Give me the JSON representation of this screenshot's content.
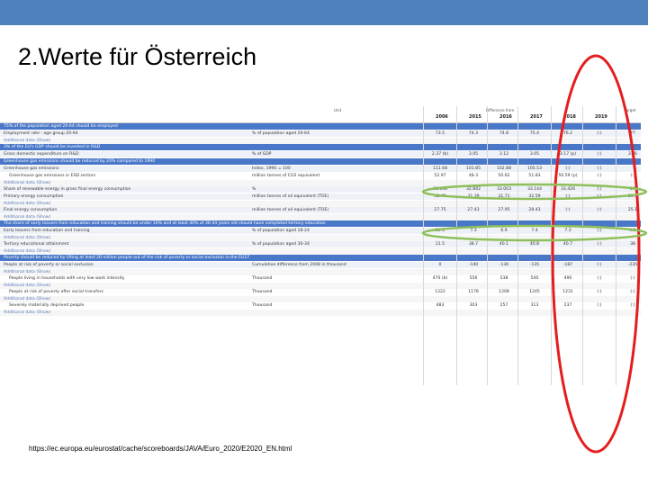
{
  "slide": {
    "title": "2.Werte für Österreich",
    "url": "https://ec.europa.eu/eurostat/cache/scoreboards/JAVA/Euro_2020/E2020_EN.html",
    "topbar_color": "#4f81bd"
  },
  "table": {
    "unit_header": "Unit",
    "target_header": "Target",
    "group_header": "Difference from",
    "years": [
      "2006",
      "2015",
      "2016",
      "2017",
      "2018",
      "2019"
    ],
    "rows": [
      {
        "type": "section",
        "label": "75% of the population aged 20-64 should be employed",
        "unit": "",
        "values": [
          "",
          "",
          "",
          "",
          "",
          ""
        ],
        "target": ""
      },
      {
        "type": "main",
        "label": "Employment rate - age group 20-64",
        "unit": "% of population aged 20-64",
        "values": [
          "73.5",
          "74.3",
          "74.8",
          "75.4",
          "76.2",
          "(:)"
        ],
        "target": "77"
      },
      {
        "type": "extra",
        "label": "Additional data (Show)",
        "unit": "",
        "values": [
          "",
          "",
          "",
          "",
          "",
          ""
        ],
        "target": ""
      },
      {
        "type": "section",
        "label": "3% of the EU's GDP should be invested in R&D",
        "unit": "",
        "values": [
          "",
          "",
          "",
          "",
          "",
          ""
        ],
        "target": ""
      },
      {
        "type": "main",
        "label": "Gross domestic expenditure on R&D",
        "unit": "% of GDP",
        "values": [
          "2.37 (b)",
          "3.05",
          "3.12",
          "3.05",
          "3.17 (p)",
          "(:)"
        ],
        "target": "3.76"
      },
      {
        "type": "section",
        "label": "Greenhouse gas emissions should be reduced by 20% compared to 1990",
        "unit": "",
        "values": [
          "",
          "",
          "",
          "",
          "",
          ""
        ],
        "target": ""
      },
      {
        "type": "main",
        "label": "Greenhouse gas emissions",
        "unit": "Index, 1990 = 100",
        "values": [
          "111.68",
          "101.85",
          "102.88",
          "105.53",
          "(:)",
          "(:)"
        ],
        "target": ""
      },
      {
        "type": "sub",
        "label": "Greenhouse gas emissions in ESD sectors",
        "unit": "million tonnes of CO2 equivalent",
        "values": [
          "52.97",
          "48.3",
          "50.62",
          "51.83",
          "50.59 (p)",
          "(:)"
        ],
        "target": "(:)"
      },
      {
        "type": "extra",
        "label": "Additional data (Show)",
        "unit": "",
        "values": [
          "",
          "",
          "",
          "",
          "",
          ""
        ],
        "target": ""
      },
      {
        "type": "main",
        "label": "Share of renewable energy in gross final energy consumption",
        "unit": "%",
        "values": [
          "26.698",
          "32.842",
          "33.003",
          "33.144",
          "33.426",
          "(:)"
        ],
        "target": "34"
      },
      {
        "type": "main",
        "label": "Primary energy consumption",
        "unit": "million tonnes of oil equivalent (TOE)",
        "values": [
          "32.49",
          "31.39",
          "31.71",
          "32.59",
          "(:)",
          "(:)"
        ],
        "target": "31.5"
      },
      {
        "type": "extra",
        "label": "Additional data (Show)",
        "unit": "",
        "values": [
          "",
          "",
          "",
          "",
          "",
          ""
        ],
        "target": ""
      },
      {
        "type": "main",
        "label": "Final energy consumption",
        "unit": "million tonnes of oil equivalent (TOE)",
        "values": [
          "27.75",
          "27.43",
          "27.95",
          "28.43",
          "(:)",
          "(:)"
        ],
        "target": "25.1"
      },
      {
        "type": "extra",
        "label": "Additional data (Show)",
        "unit": "",
        "values": [
          "",
          "",
          "",
          "",
          "",
          ""
        ],
        "target": ""
      },
      {
        "type": "section",
        "label": "The share of early leavers from education and training should be under 10% and at least 40% of 30-34 years old should have completed tertiary education",
        "unit": "",
        "values": [
          "",
          "",
          "",
          "",
          "",
          ""
        ],
        "target": ""
      },
      {
        "type": "main",
        "label": "Early leavers from education and training",
        "unit": "% of population aged 18-24",
        "values": [
          "10.1",
          "7.3",
          "6.9",
          "7.4",
          "7.3",
          "(:)"
        ],
        "target": "9.5"
      },
      {
        "type": "extra",
        "label": "Additional data (Show)",
        "unit": "",
        "values": [
          "",
          "",
          "",
          "",
          "",
          ""
        ],
        "target": ""
      },
      {
        "type": "main",
        "label": "Tertiary educational attainment",
        "unit": "% of population aged 30-34",
        "values": [
          "21.5",
          "38.7",
          "40.1",
          "40.8",
          "40.7",
          "(:)"
        ],
        "target": "38"
      },
      {
        "type": "extra",
        "label": "Additional data (Show)",
        "unit": "",
        "values": [
          "",
          "",
          "",
          "",
          "",
          ""
        ],
        "target": ""
      },
      {
        "type": "section",
        "label": "Poverty should be reduced by lifting at least 20 million people out of the risk of poverty or social exclusion in the EU27",
        "unit": "",
        "values": [
          "",
          "",
          "",
          "",
          "",
          ""
        ],
        "target": ""
      },
      {
        "type": "main",
        "label": "People at risk of poverty or social exclusion",
        "unit": "Cumulative difference from 2008 in thousand",
        "values": [
          "0",
          "-140",
          "-136",
          "-135",
          "-187",
          "(:)"
        ],
        "target": "-235"
      },
      {
        "type": "extra",
        "label": "Additional data (Show)",
        "unit": "",
        "values": [
          "",
          "",
          "",
          "",
          "",
          ""
        ],
        "target": ""
      },
      {
        "type": "sub",
        "label": "People living in households with very low work intensity",
        "unit": "Thousand",
        "values": [
          "470 (b)",
          "556",
          "538",
          "540",
          "490",
          "(:)"
        ],
        "target": "(:)"
      },
      {
        "type": "extra",
        "label": "Additional data (Show)",
        "unit": "",
        "values": [
          "",
          "",
          "",
          "",
          "",
          ""
        ],
        "target": ""
      },
      {
        "type": "sub",
        "label": "People at risk of poverty after social transfers",
        "unit": "Thousand",
        "values": [
          "1222",
          "1178",
          "1208",
          "1245",
          "1231",
          "(:)"
        ],
        "target": "(:)"
      },
      {
        "type": "extra",
        "label": "Additional data (Show)",
        "unit": "",
        "values": [
          "",
          "",
          "",
          "",
          "",
          ""
        ],
        "target": ""
      },
      {
        "type": "sub",
        "label": "Severely materially deprived people",
        "unit": "Thousand",
        "values": [
          "483",
          "303",
          "257",
          "313",
          "237",
          "(:)"
        ],
        "target": "(:)"
      },
      {
        "type": "extra",
        "label": "Additional data (Show)",
        "unit": "",
        "values": [
          "",
          "",
          "",
          "",
          "",
          ""
        ],
        "target": ""
      }
    ]
  },
  "annotations": {
    "oval_color": "#e41e1e",
    "highlight_color": "#8dbf5a"
  }
}
